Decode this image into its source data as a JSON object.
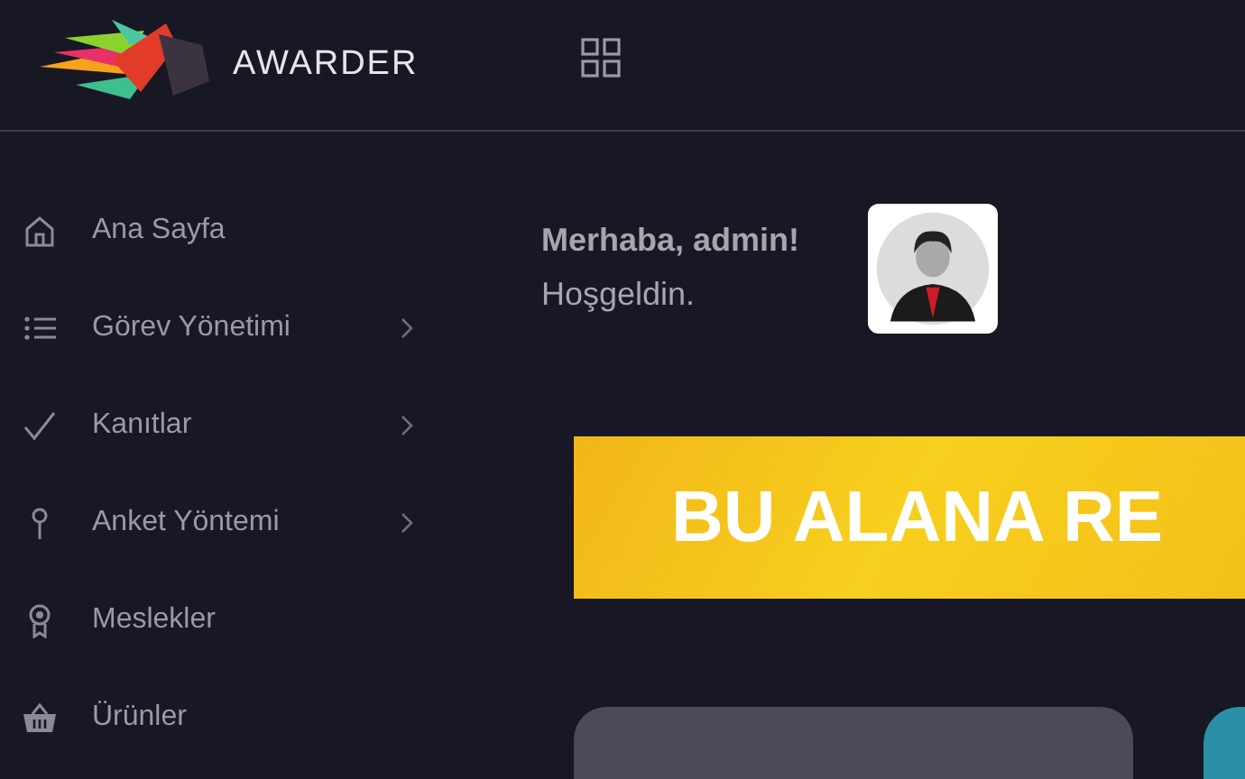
{
  "header": {
    "brand": "AWARDER"
  },
  "sidebar": {
    "items": [
      {
        "label": "Ana Sayfa",
        "expandable": false
      },
      {
        "label": "Görev Yönetimi",
        "expandable": true
      },
      {
        "label": "Kanıtlar",
        "expandable": true
      },
      {
        "label": "Anket Yöntemi",
        "expandable": true
      },
      {
        "label": "Meslekler",
        "expandable": false
      },
      {
        "label": "Ürünler",
        "expandable": false
      }
    ]
  },
  "welcome": {
    "greeting": "Merhaba, admin!",
    "subtitle": "Hoşgeldin."
  },
  "banner": {
    "text": "BU ALANA RE"
  }
}
